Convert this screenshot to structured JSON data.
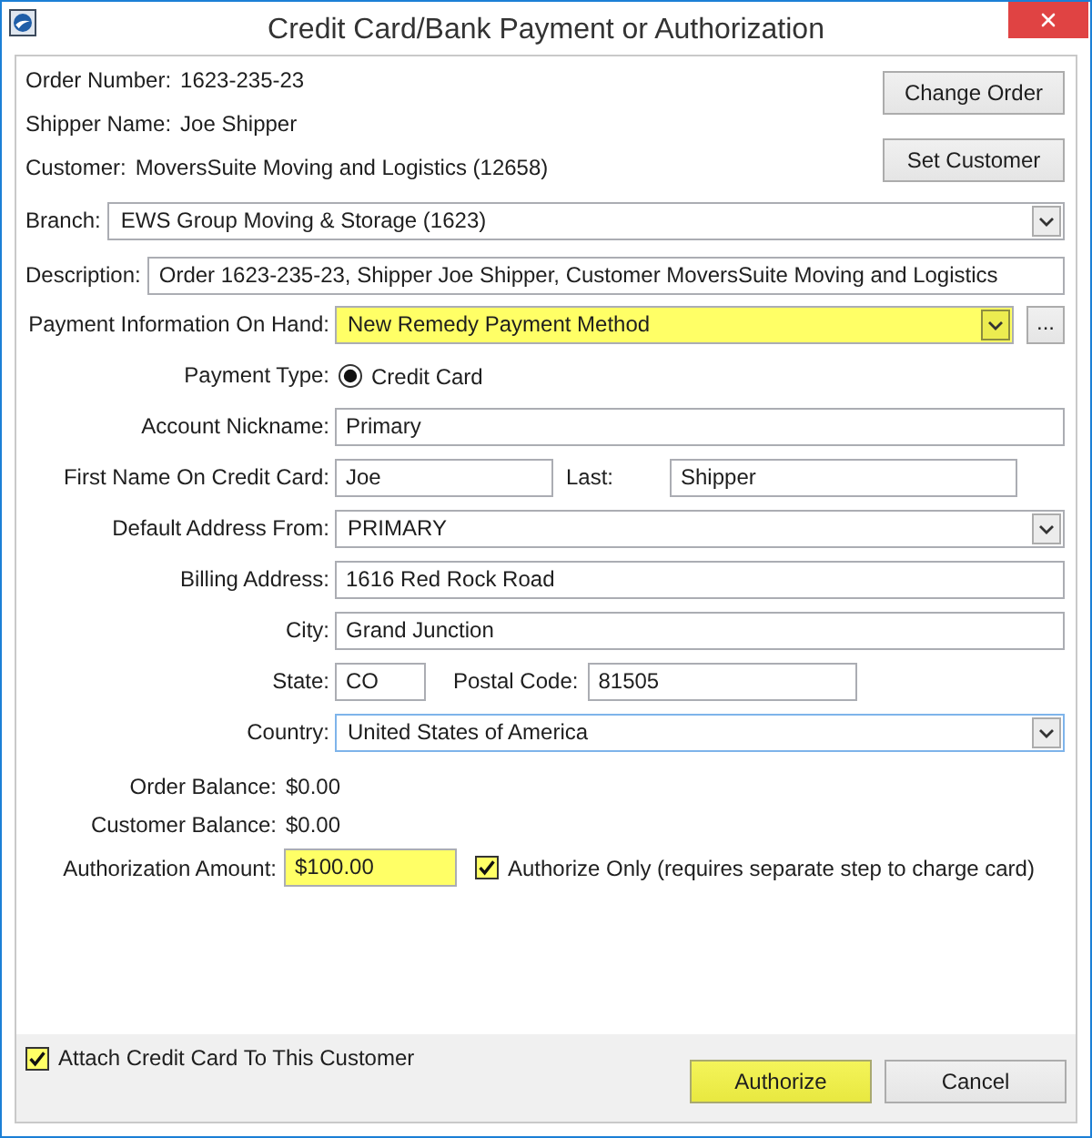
{
  "window": {
    "title": "Credit Card/Bank Payment or Authorization"
  },
  "order_info": [
    {
      "label": "Order Number:",
      "value": "1623-235-23"
    },
    {
      "label": "Shipper Name:",
      "value": "Joe Shipper"
    },
    {
      "label": "Customer:",
      "value": "MoversSuite Moving and Logistics (12658)"
    }
  ],
  "header_buttons": [
    {
      "label": "Change Order"
    },
    {
      "label": "Set Customer"
    }
  ],
  "top_fields": [
    {
      "kind": "combo",
      "label": "Branch:",
      "value": "EWS Group Moving & Storage (1623)"
    },
    {
      "kind": "text",
      "label": "Description:",
      "value": "Order 1623-235-23, Shipper Joe Shipper, Customer MoversSuite Moving and Logistics"
    }
  ],
  "form": [
    {
      "kind": "combo",
      "label": "Payment Information On Hand:",
      "value": "New Remedy Payment Method",
      "highlighted": true,
      "focused": false,
      "button": "..."
    },
    {
      "kind": "radio",
      "label": "Payment Type:",
      "option": "Credit Card",
      "selected": true
    },
    {
      "kind": "text",
      "label": "Account Nickname:",
      "value": "Primary",
      "highlighted": false,
      "focused": false
    },
    {
      "kind": "fullname",
      "label": "First Name On Credit Card:",
      "value": "Joe",
      "label_2": "Last:",
      "value_2": "Shipper"
    },
    {
      "kind": "combo",
      "label": "Default Address From:",
      "value": "PRIMARY",
      "highlighted": false,
      "focused": false
    },
    {
      "kind": "text",
      "label": "Billing Address:",
      "value": "1616 Red Rock Road",
      "highlighted": false,
      "focused": false
    },
    {
      "kind": "text",
      "label": "City:",
      "value": "Grand Junction",
      "highlighted": false,
      "focused": false
    },
    {
      "kind": "statezip",
      "label": "State:",
      "value": "CO",
      "label_2": "Postal Code:",
      "value_2": "81505"
    },
    {
      "kind": "combo",
      "label": "Country:",
      "value": "United States of America",
      "highlighted": false,
      "focused": true
    }
  ],
  "balances": [
    {
      "label": "Order Balance:",
      "value": "$0.00"
    },
    {
      "label": "Customer Balance:",
      "value": "$0.00"
    }
  ],
  "authorization": {
    "label": "Authorization Amount:",
    "value": "$100.00",
    "highlighted": true,
    "checkbox": {
      "label": "Authorize Only (requires separate step to charge card)",
      "checked": true,
      "highlighted": true
    }
  },
  "footer": {
    "checkbox": {
      "label": "Attach Credit Card To This Customer",
      "checked": true,
      "highlighted": true
    },
    "buttons": [
      {
        "label": "Authorize",
        "highlighted": true
      },
      {
        "label": "Cancel",
        "highlighted": false
      }
    ]
  }
}
